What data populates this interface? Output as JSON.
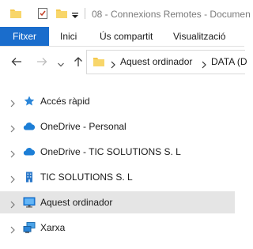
{
  "window": {
    "title": "08 - Connexions Remotes - Documen"
  },
  "ribbon": {
    "tabs": [
      {
        "label": "Fitxer"
      },
      {
        "label": "Inici"
      },
      {
        "label": "Ús compartit"
      },
      {
        "label": "Visualització"
      }
    ]
  },
  "address": {
    "crumbs": [
      {
        "label": "Aquest ordinador"
      },
      {
        "label": "DATA (D"
      }
    ]
  },
  "tree": {
    "items": [
      {
        "label": "Accés ràpid",
        "icon": "star-icon"
      },
      {
        "label": "OneDrive - Personal",
        "icon": "cloud-icon"
      },
      {
        "label": "OneDrive - TIC SOLUTIONS S. L",
        "icon": "cloud-icon"
      },
      {
        "label": "TIC SOLUTIONS S. L",
        "icon": "building-icon"
      },
      {
        "label": "Aquest ordinador",
        "icon": "computer-icon",
        "selected": true
      },
      {
        "label": "Xarxa",
        "icon": "network-icon"
      }
    ]
  },
  "colors": {
    "accent": "#1a6dcc",
    "folder": "#f5c84c",
    "selection": "#e5e5e5"
  }
}
